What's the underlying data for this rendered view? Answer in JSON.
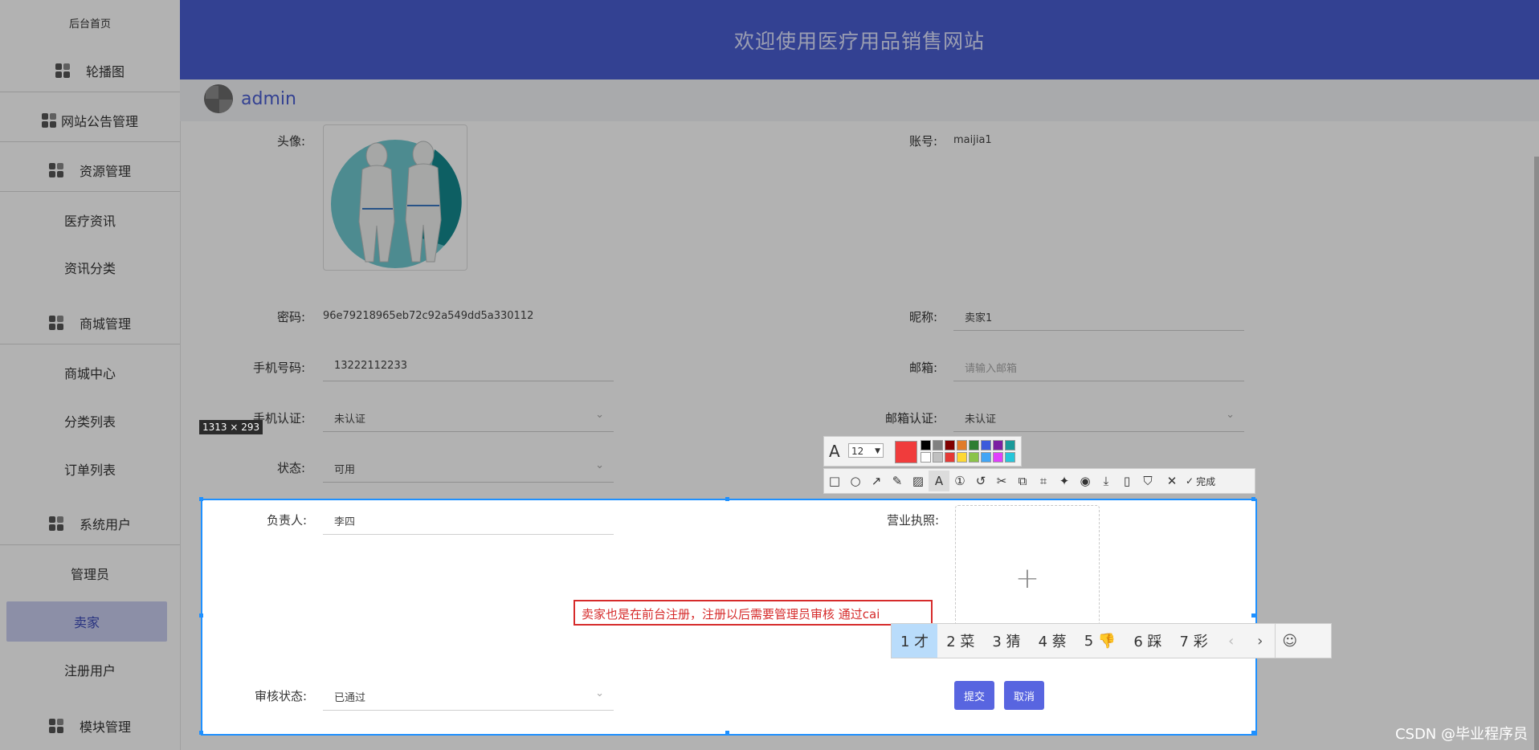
{
  "sidebar": {
    "top_label": "后台首页",
    "items": [
      {
        "label": "轮播图",
        "group": true
      },
      {
        "label": "网站公告管理",
        "group": true
      },
      {
        "label": "资源管理",
        "group": true
      },
      {
        "label": "医疗资讯",
        "group": false
      },
      {
        "label": "资讯分类",
        "group": false
      },
      {
        "label": "商城管理",
        "group": true
      },
      {
        "label": "商城中心",
        "group": false
      },
      {
        "label": "分类列表",
        "group": false
      },
      {
        "label": "订单列表",
        "group": false
      },
      {
        "label": "系统用户",
        "group": true
      },
      {
        "label": "管理员",
        "group": false
      },
      {
        "label": "卖家",
        "group": false,
        "active": true
      },
      {
        "label": "注册用户",
        "group": false
      },
      {
        "label": "模块管理",
        "group": true
      }
    ]
  },
  "header": {
    "title": "欢迎使用医疗用品销售网站"
  },
  "userbar": {
    "username": "admin"
  },
  "form": {
    "avatar_label": "头像:",
    "account_label": "账号:",
    "account_value": "maijia1",
    "password_label": "密码:",
    "password_value": "96e79218965eb72c92a549dd5a330112",
    "nickname_label": "昵称:",
    "nickname_value": "卖家1",
    "phone_label": "手机号码:",
    "phone_value": "13222112233",
    "email_label": "邮箱:",
    "email_placeholder": "请输入邮箱",
    "phone_verify_label": "手机认证:",
    "phone_verify_value": "未认证",
    "email_verify_label": "邮箱认证:",
    "email_verify_value": "未认证",
    "status_label": "状态:",
    "status_value": "可用",
    "owner_label": "负责人:",
    "owner_value": "李四",
    "license_label": "营业执照:",
    "license_upload_icon": "+",
    "review_label": "审核状态:",
    "review_value": "已通过",
    "submit_label": "提交",
    "cancel_label": "取消"
  },
  "screenshot_tool": {
    "size_tag": "1313 × 293",
    "font_size": "12",
    "finish_label": "完成",
    "current_color": "#f03c3c",
    "palette": [
      "#000000",
      "#808080",
      "#800000",
      "#e07b2a",
      "#2e7d32",
      "#3b5bdb",
      "#7b1fa2",
      "#1a9a9a",
      "#ffffff",
      "#c0c0c0",
      "#e53935",
      "#fdd835",
      "#8bc34a",
      "#42a5f5",
      "#e040fb",
      "#26c6da"
    ],
    "annotation_text": "卖家也是在前台注册，注册以后需要管理员审核    通过cai"
  },
  "ime": {
    "candidates": [
      "1 才",
      "2 菜",
      "3 猜",
      "4 蔡",
      "5 👎",
      "6 踩",
      "7 彩"
    ],
    "prev": "‹",
    "next": "›",
    "emoji": "☺"
  },
  "watermark": "CSDN @毕业程序员"
}
